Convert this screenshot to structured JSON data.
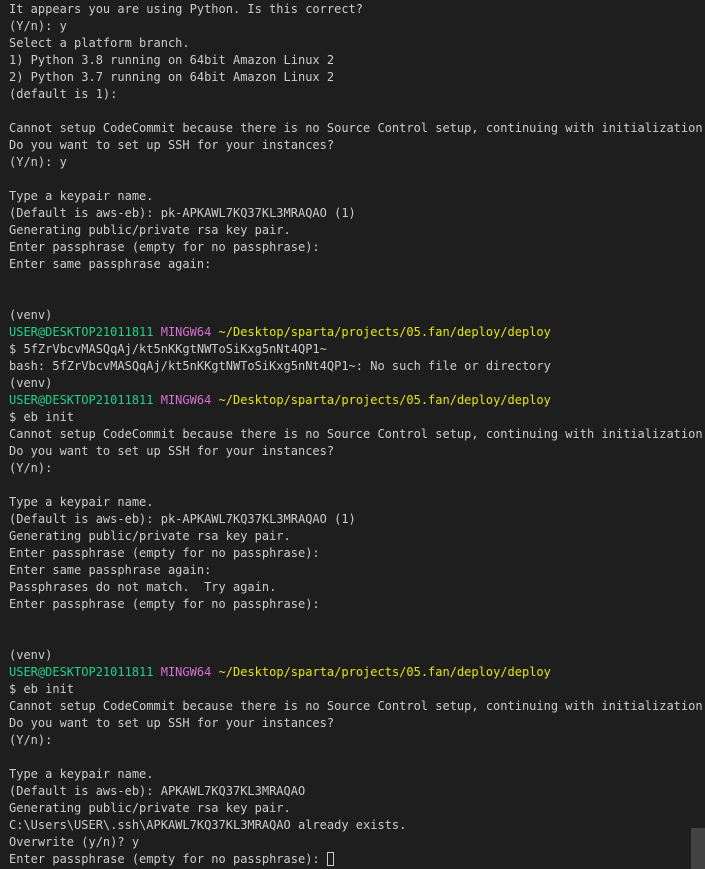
{
  "terminal": {
    "lines": [
      "It appears you are using Python. Is this correct?",
      "(Y/n): y",
      "Select a platform branch.",
      "1) Python 3.8 running on 64bit Amazon Linux 2",
      "2) Python 3.7 running on 64bit Amazon Linux 2",
      "(default is 1):",
      "",
      "Cannot setup CodeCommit because there is no Source Control setup, continuing with initialization",
      "Do you want to set up SSH for your instances?",
      "(Y/n): y",
      "",
      "Type a keypair name.",
      "(Default is aws-eb): pk-APKAWL7KQ37KL3MRAQAO (1)",
      "Generating public/private rsa key pair.",
      "Enter passphrase (empty for no passphrase):",
      "Enter same passphrase again:",
      "",
      "",
      "(venv)",
      {
        "prompt": true
      },
      "$ 5fZrVbcvMASQqAj/kt5nKKgtNWToSiKxg5nNt4QP1~",
      "bash: 5fZrVbcvMASQqAj/kt5nKKgtNWToSiKxg5nNt4QP1~: No such file or directory",
      "(venv)",
      {
        "prompt": true
      },
      "$ eb init",
      "Cannot setup CodeCommit because there is no Source Control setup, continuing with initialization",
      "Do you want to set up SSH for your instances?",
      "(Y/n):",
      "",
      "Type a keypair name.",
      "(Default is aws-eb): pk-APKAWL7KQ37KL3MRAQAO (1)",
      "Generating public/private rsa key pair.",
      "Enter passphrase (empty for no passphrase):",
      "Enter same passphrase again:",
      "Passphrases do not match.  Try again.",
      "Enter passphrase (empty for no passphrase):",
      "",
      "",
      "(venv)",
      {
        "prompt": true
      },
      "$ eb init",
      "Cannot setup CodeCommit because there is no Source Control setup, continuing with initialization",
      "Do you want to set up SSH for your instances?",
      "(Y/n):",
      "",
      "Type a keypair name.",
      "(Default is aws-eb): APKAWL7KQ37KL3MRAQAO",
      "Generating public/private rsa key pair.",
      "C:\\Users\\USER\\.ssh\\APKAWL7KQ37KL3MRAQAO already exists.",
      "Overwrite (y/n)? y",
      {
        "text": "Enter passphrase (empty for no passphrase): ",
        "cursor": true
      }
    ],
    "prompt": {
      "user_host": "USER@DESKTOP21011811",
      "system": "MINGW64",
      "path": "~/Desktop/sparta/projects/05.fan/deploy/deploy"
    },
    "colors": {
      "background": "#1e1e1e",
      "foreground": "#cccccc",
      "user_host": "#23d18b",
      "system": "#d670d6",
      "path": "#e5e510"
    }
  }
}
